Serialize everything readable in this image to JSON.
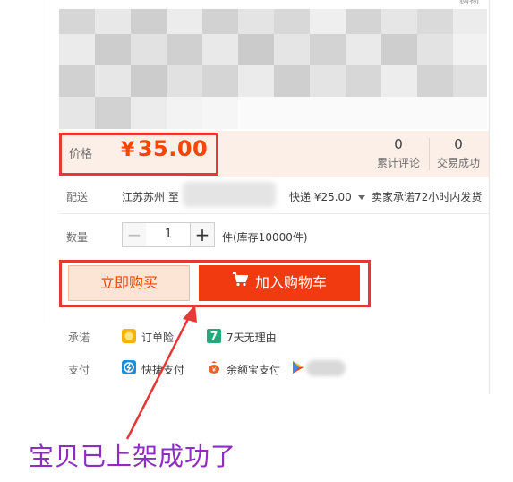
{
  "corner_text": "购物",
  "price": {
    "label": "价格",
    "currency": "¥",
    "amount": "35.00",
    "accent_color": "#ff4400"
  },
  "stats": [
    {
      "value": "0",
      "label": "累计评论"
    },
    {
      "value": "0",
      "label": "交易成功"
    }
  ],
  "shipping": {
    "label": "配送",
    "origin": "江苏苏州 至",
    "fee": "快递 ¥25.00",
    "promise": "卖家承诺72小时内发货"
  },
  "quantity": {
    "label": "数量",
    "value": "1",
    "minus": "−",
    "plus": "+",
    "stock": "件(库存10000件)"
  },
  "buttons": {
    "buy_now": "立即购买",
    "add_to_cart": "加入购物车",
    "cart_color": "#f23a11"
  },
  "promise": {
    "label": "承诺",
    "items": [
      {
        "icon": "insurance-icon",
        "text": "订单险"
      },
      {
        "icon": "seven-day-return-icon",
        "badge": "7",
        "text": "7天无理由"
      }
    ]
  },
  "payment": {
    "label": "支付",
    "items": [
      {
        "icon": "quick-pay-icon",
        "text": "快捷支付"
      },
      {
        "icon": "yuebao-icon",
        "text": "余额宝支付"
      }
    ]
  },
  "annotation": {
    "caption": "宝贝已上架成功了",
    "color": "#e53935"
  }
}
